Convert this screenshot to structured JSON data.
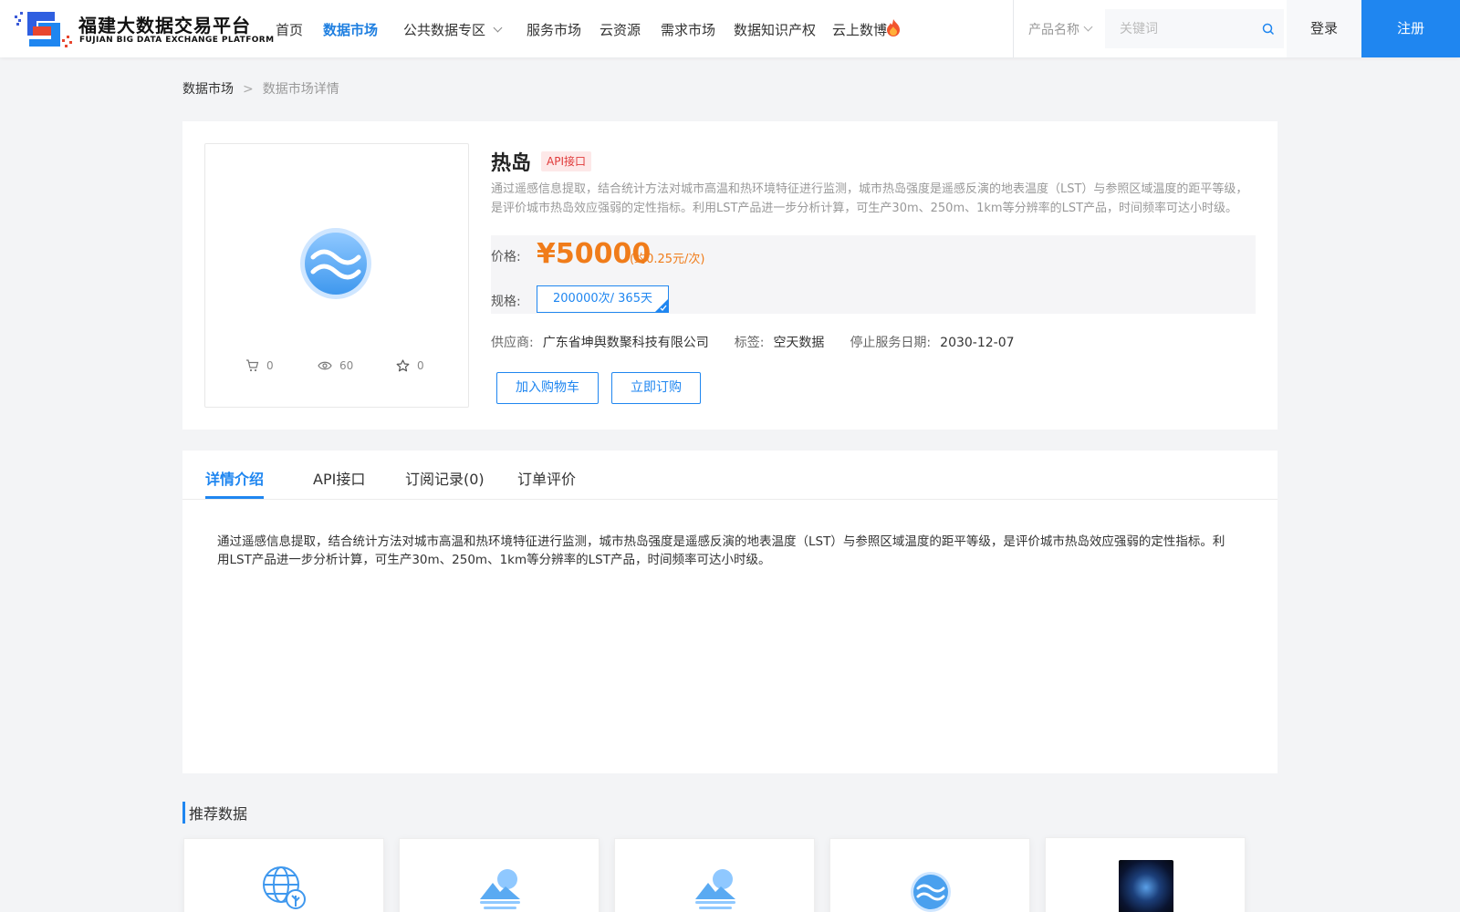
{
  "header": {
    "logo_title": "福建大数据交易平台",
    "logo_subtitle": "FUJIAN BIG DATA EXCHANGE  PLATFORM",
    "nav": [
      {
        "label": "首页",
        "active": false
      },
      {
        "label": "数据市场",
        "active": true
      },
      {
        "label": "公共数据专区",
        "active": false,
        "dropdown": true
      },
      {
        "label": "服务市场",
        "active": false
      },
      {
        "label": "云资源",
        "active": false
      },
      {
        "label": "需求市场",
        "active": false
      },
      {
        "label": "数据知识产权",
        "active": false
      },
      {
        "label": "云上数博",
        "active": false,
        "icon": "fire-icon"
      }
    ],
    "search": {
      "category": "产品名称",
      "placeholder": "关键词",
      "value": ""
    },
    "login_label": "登录",
    "register_label": "注册"
  },
  "breadcrumb": {
    "home": "数据市场",
    "separator": ">",
    "current": "数据市场详情"
  },
  "product": {
    "title": "热岛",
    "badge": "API接口",
    "description": "通过遥感信息提取，结合统计方法对城市高温和热环境特征进行监测，城市热岛强度是遥感反演的地表温度（LST）与参照区域温度的距平等级，是评价城市热岛效应强弱的定性指标。利用LST产品进一步分析计算，可生产30m、250m、1km等分辨率的LST产品，时间频率可达小时级。",
    "stats": {
      "cart": "0",
      "views": "60",
      "favorites": "0"
    },
    "price_label": "价格:",
    "price_value": "¥50000",
    "price_unit": "(约0.25元/次)",
    "spec_label": "规格:",
    "spec_option": "200000次/ 365天",
    "supplier_label": "供应商:",
    "supplier": "广东省坤舆数聚科技有限公司",
    "tag_label": "标签:",
    "tag": "空天数据",
    "stop_date_label": "停止服务日期:",
    "stop_date": "2030-12-07",
    "add_cart_label": "加入购物车",
    "buy_label": "立即订购"
  },
  "tabs": [
    {
      "label": "详情介绍",
      "active": true
    },
    {
      "label": "API接口",
      "active": false
    },
    {
      "label": "订阅记录(0)",
      "active": false
    },
    {
      "label": "订单评价",
      "active": false
    }
  ],
  "detail_text": "通过遥感信息提取，结合统计方法对城市高温和热环境特征进行监测，城市热岛强度是遥感反演的地表温度（LST）与参照区域温度的距平等级，是评价城市热岛效应强弱的定性指标。利用LST产品进一步分析计算，可生产30m、250m、1km等分辨率的LST产品，时间频率可达小时级。",
  "recommended": {
    "title": "推荐数据",
    "cards": [
      {
        "icon": "globe-plant-icon"
      },
      {
        "icon": "mountain-sun-icon"
      },
      {
        "icon": "mountain-sun-icon"
      },
      {
        "icon": "water-waves-icon"
      },
      {
        "icon": "earth-photo"
      }
    ]
  },
  "colors": {
    "accent": "#1f86f0",
    "price": "#f07c1a",
    "badge_text": "#e03a3a",
    "badge_bg": "#fde8e8"
  }
}
